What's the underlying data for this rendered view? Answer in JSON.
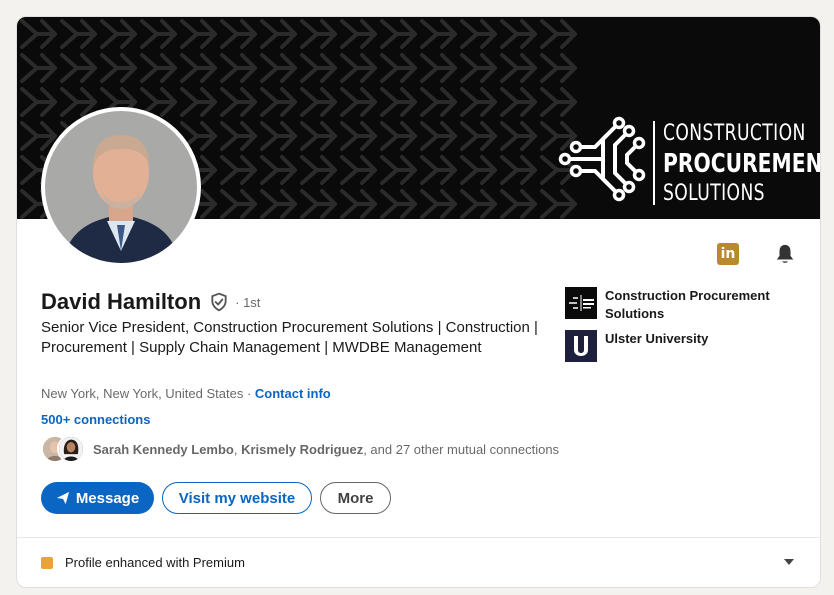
{
  "banner": {
    "line1": "CONSTRUCTION",
    "line2": "PROCUREMENT",
    "line3": "SOLUTIONS"
  },
  "profile": {
    "name": "David Hamilton",
    "degree": "· 1st",
    "headline": "Senior Vice President, Construction Procurement Solutions | Construction | Procurement | Supply Chain Management | MWDBE Management",
    "location": "New York, New York, United States",
    "location_separator": " · ",
    "contact_info": "Contact info",
    "connections": "500+ connections"
  },
  "mutual": {
    "name1": "Sarah Kennedy Lembo",
    "separator": ", ",
    "name2": "Krismely Rodriguez",
    "rest": ", and 27 other mutual connections"
  },
  "actions": {
    "message": "Message",
    "visit_website": "Visit my website",
    "more": "More"
  },
  "experience": [
    {
      "label": "Construction Procurement Solutions"
    },
    {
      "label": "Ulster University"
    }
  ],
  "top_icons": {
    "linkedin_badge": "in"
  },
  "premium": {
    "label": "Profile enhanced with Premium"
  },
  "colors": {
    "brand_blue": "#0a66c2",
    "premium_gold": "#e7a33e",
    "badge_gold": "#b98a2c",
    "banner_bg": "#0a0a0a"
  },
  "icons": [
    "verified-shield-icon",
    "linkedin-icon",
    "bell-icon",
    "send-icon",
    "premium-icon",
    "caret-down-icon"
  ]
}
